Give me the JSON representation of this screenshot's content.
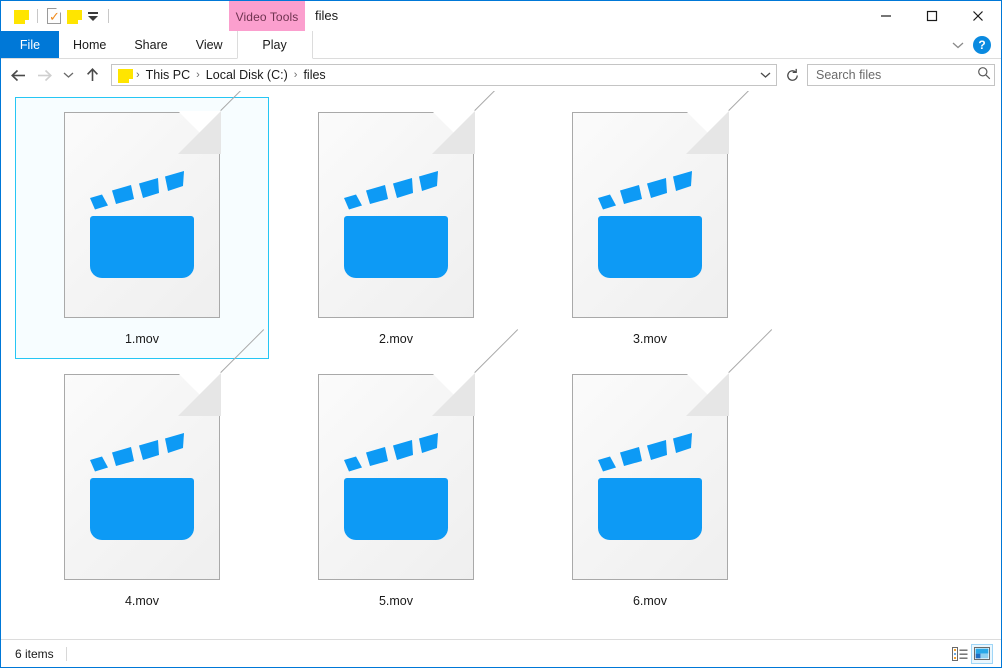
{
  "window": {
    "title": "files",
    "accent_color": "#0078d7",
    "contextual_tools_label": "Video Tools",
    "contextual_tools_color": "#fb9fce"
  },
  "quick_access": {
    "items": [
      {
        "name": "folder-icon",
        "label": "Folder"
      },
      {
        "name": "properties-icon",
        "label": "Properties"
      },
      {
        "name": "new-folder-icon",
        "label": "New folder"
      },
      {
        "name": "customize-dropdown",
        "label": "Customize Quick Access Toolbar"
      }
    ]
  },
  "window_controls": {
    "minimize": "Minimize",
    "maximize": "Maximize",
    "close": "Close"
  },
  "ribbon": {
    "tabs": [
      {
        "label": "File",
        "active": true
      },
      {
        "label": "Home",
        "active": false
      },
      {
        "label": "Share",
        "active": false
      },
      {
        "label": "View",
        "active": false
      },
      {
        "label": "Play",
        "active": false,
        "contextual": true
      }
    ],
    "collapse_label": "Minimize the Ribbon",
    "help_label": "?"
  },
  "navigation": {
    "back": "Back",
    "forward": "Forward",
    "recent": "Recent locations",
    "up": "Up one level",
    "refresh": "Refresh"
  },
  "breadcrumb": {
    "icon": "folder-icon",
    "separator": "›",
    "items": [
      "This PC",
      "Local Disk (C:)",
      "files"
    ],
    "dropdown_label": "Previous locations"
  },
  "search": {
    "placeholder": "Search files",
    "value": "",
    "icon": "search-icon"
  },
  "files": [
    {
      "name": "1.mov",
      "type": "mov",
      "selected": true
    },
    {
      "name": "2.mov",
      "type": "mov",
      "selected": false
    },
    {
      "name": "3.mov",
      "type": "mov",
      "selected": false
    },
    {
      "name": "4.mov",
      "type": "mov",
      "selected": false
    },
    {
      "name": "5.mov",
      "type": "mov",
      "selected": false
    },
    {
      "name": "6.mov",
      "type": "mov",
      "selected": false
    }
  ],
  "icon_colors": {
    "clapper_blue": "#0d9af5",
    "page_border": "#a9a9a9",
    "fold_grey": "#e6e6e6",
    "selection_border": "#26c6f4",
    "selection_fill": "#f7fdff"
  },
  "status_bar": {
    "item_count": "6 items",
    "views": [
      {
        "name": "details-view",
        "label": "Details view",
        "active": false
      },
      {
        "name": "large-icons-view",
        "label": "Large icons view",
        "active": true
      }
    ]
  }
}
